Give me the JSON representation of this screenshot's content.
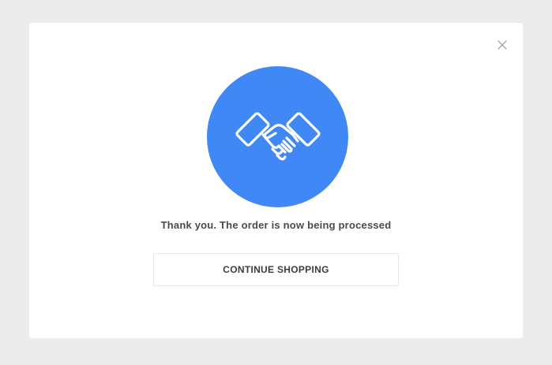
{
  "modal": {
    "message": "Thank you. The order is now being processed",
    "continue_label": "CONTINUE SHOPPING",
    "close_icon": "close-icon",
    "hero_icon": "handshake-icon"
  },
  "colors": {
    "overlay": "#ececec",
    "card": "#ffffff",
    "accent": "#3f88f6",
    "text": "#4a4a4a"
  }
}
